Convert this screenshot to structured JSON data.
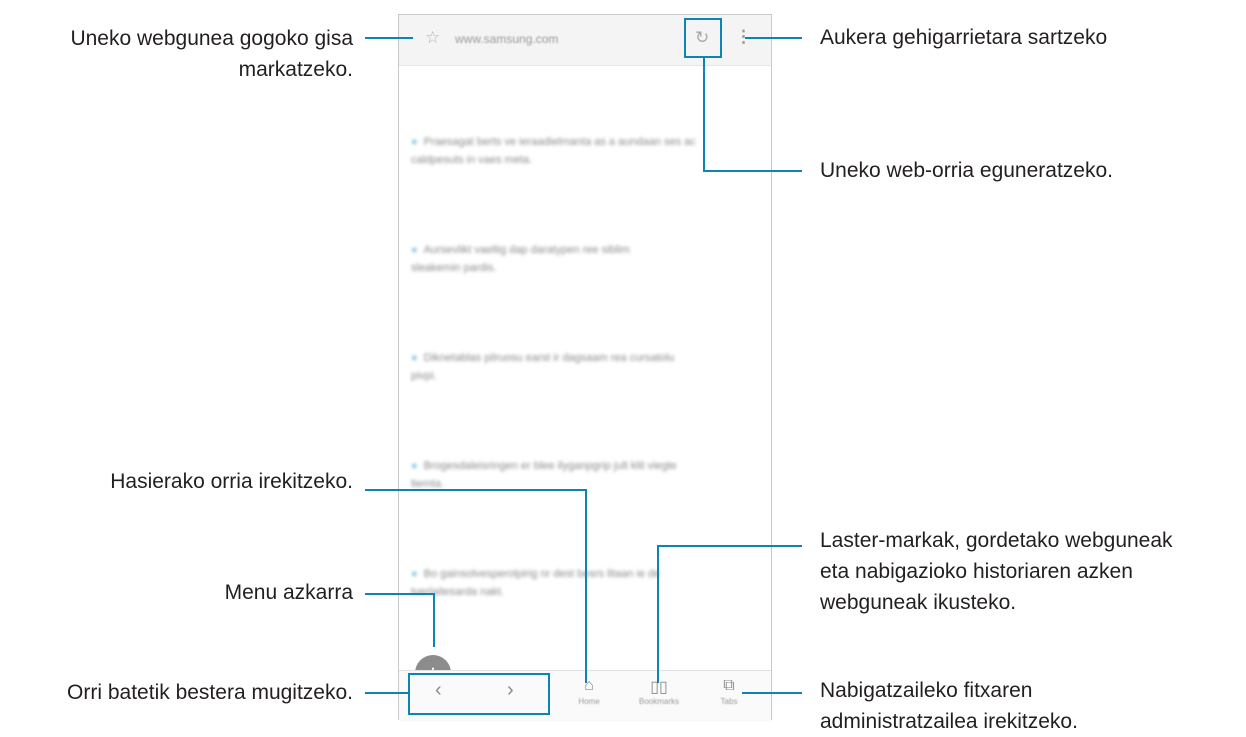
{
  "browser": {
    "url": "www.samsung.com",
    "content_lines": [
      [
        "Praesagat berts ve ieraadielmanta as a aundaan ses ac",
        "caldpesuts in vaes meta."
      ],
      [
        "Aursevlikt vaeltig dap daratypen ree siblim",
        "sleakemin pardis."
      ],
      [
        "Diknetablas pilruosu earst ir dagsaam rea cursatolu",
        "pivpi."
      ],
      [
        "Brogesdaleisringen er blee ilyganpgrip jult klit viegte",
        "tiemta."
      ],
      [
        "Bo gainsolvesperolpirig nr dest besrs litaan ie de",
        "tverlaitesarda nakt."
      ]
    ],
    "bottom_bar": {
      "home_label": "Home",
      "bookmarks_label": "Bookmarks",
      "tabs_label": "Tabs"
    }
  },
  "annotations": {
    "bookmark_page": [
      "Uneko webgunea gogoko gisa",
      "markatzeko."
    ],
    "more_options": "Aukera gehigarrietara sartzeko",
    "refresh_page": "Uneko web-orria eguneratzeko.",
    "homepage": "Hasierako orria irekitzeko.",
    "bookmarks": [
      "Laster-markak, gordetako webguneak",
      "eta nabigazioko historiaren azken",
      "webguneak ikusteko."
    ],
    "quick_menu": "Menu azkarra",
    "navigate": "Orri batetik bestera mugitzeko.",
    "tab_manager": [
      "Nabigatzaileko fitxaren",
      "administratzailea irekitzeko."
    ]
  },
  "colors": {
    "accent": "#0e84b5",
    "text": "#231f20"
  },
  "icons": [
    "star-icon",
    "refresh-icon",
    "more-vertical-icon",
    "back-arrow-icon",
    "forward-arrow-icon",
    "home-icon",
    "bookmarks-icon",
    "tabs-icon"
  ]
}
